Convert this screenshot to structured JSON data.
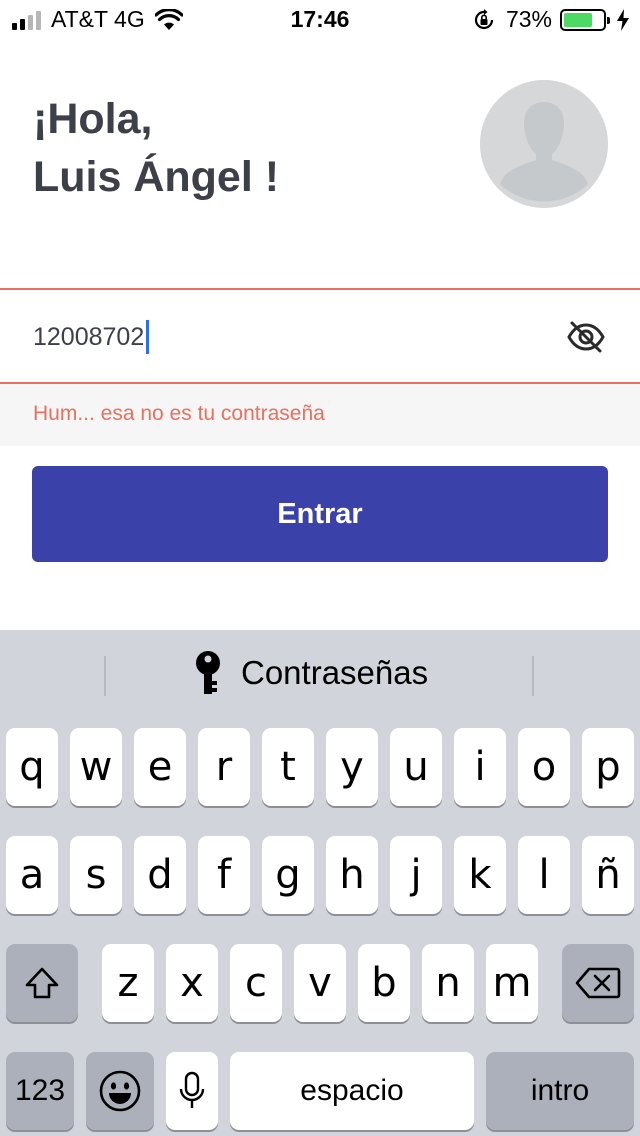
{
  "status_bar": {
    "carrier": "AT&T 4G",
    "time": "17:46",
    "battery": "73%",
    "battery_level": 0.73
  },
  "greeting": {
    "line1": "¡Hola,",
    "line2": "Luis Ángel !"
  },
  "password": {
    "value": "12008702",
    "error": "Hum... esa no es tu contraseña"
  },
  "actions": {
    "enter_label": "Entrar"
  },
  "colors": {
    "primary": "#3a41a9",
    "error": "#e9705f",
    "text": "#3d3f49"
  },
  "keyboard": {
    "suggestion": "Contraseñas",
    "row1": [
      "q",
      "w",
      "e",
      "r",
      "t",
      "y",
      "u",
      "i",
      "o",
      "p"
    ],
    "row2": [
      "a",
      "s",
      "d",
      "f",
      "g",
      "h",
      "j",
      "k",
      "l",
      "ñ"
    ],
    "row3": [
      "z",
      "x",
      "c",
      "v",
      "b",
      "n",
      "m"
    ],
    "numbers_label": "123",
    "space_label": "espacio",
    "return_label": "intro"
  }
}
